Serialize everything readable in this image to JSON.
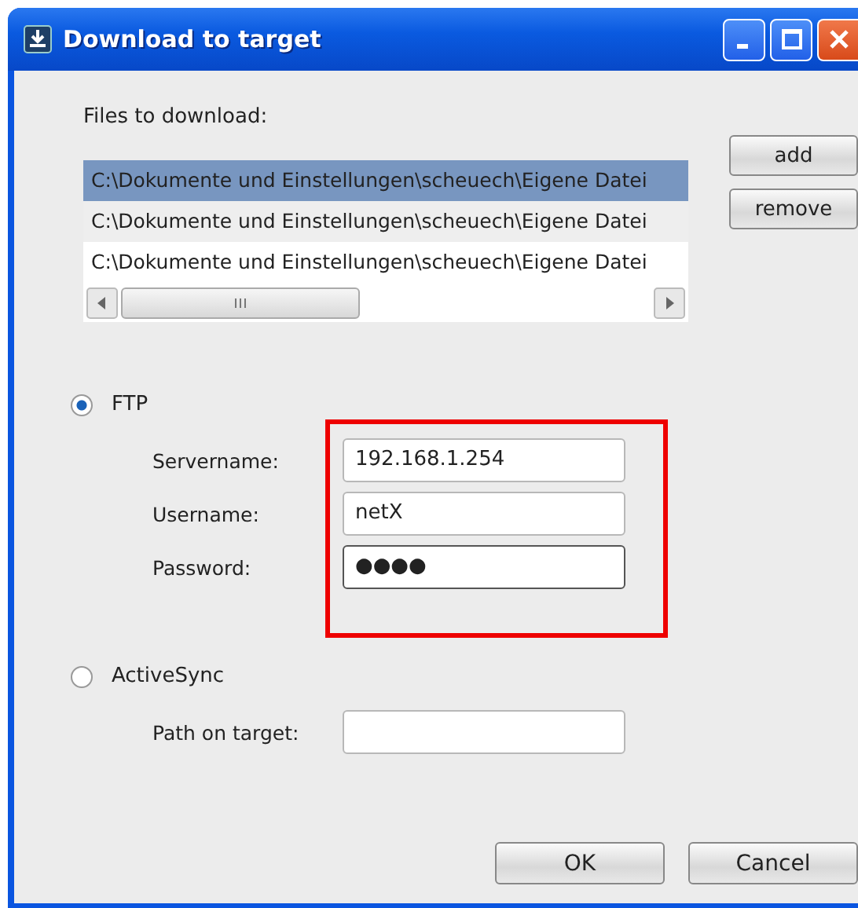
{
  "window": {
    "title": "Download to target"
  },
  "files": {
    "label": "Files to download:",
    "rows": [
      {
        "text": "C:\\Dokumente und Einstellungen\\scheuech\\Eigene Datei",
        "selected": true
      },
      {
        "text": "C:\\Dokumente und Einstellungen\\scheuech\\Eigene Datei",
        "selected": false
      },
      {
        "text": "C:\\Dokumente und Einstellungen\\scheuech\\Eigene Datei",
        "selected": false
      }
    ],
    "buttons": [
      "add",
      "remove"
    ]
  },
  "ftp": {
    "label": "FTP",
    "selected": true,
    "fields": [
      {
        "label": "Servername:",
        "value": "192.168.1.254",
        "focused": false
      },
      {
        "label": "Username:",
        "value": "netX",
        "focused": false
      },
      {
        "label": "Password:",
        "value": "●●●●",
        "focused": true
      }
    ]
  },
  "activesync": {
    "label": "ActiveSync",
    "selected": false,
    "fields": [
      {
        "label": "Path on target:",
        "focused": false
      }
    ]
  },
  "buttons": [
    "OK",
    "Cancel"
  ]
}
